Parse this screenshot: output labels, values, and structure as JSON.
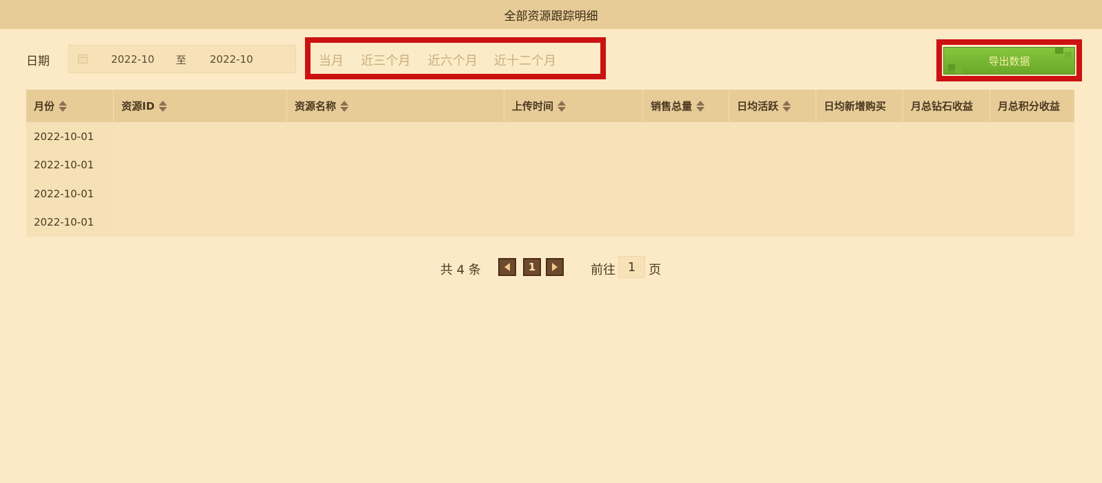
{
  "header": {
    "title": "全部资源跟踪明细"
  },
  "filters": {
    "date_label": "日期",
    "date_from": "2022-10",
    "date_sep": "至",
    "date_to": "2022-10",
    "quick_ranges": [
      "当月",
      "近三个月",
      "近六个月",
      "近十二个月"
    ]
  },
  "toolbar": {
    "export_label": "导出数据"
  },
  "table": {
    "columns": [
      "月份",
      "资源ID",
      "资源名称",
      "上传时间",
      "销售总量",
      "日均活跃",
      "日均新增购买",
      "月总钻石收益",
      "月总积分收益"
    ],
    "rows": [
      {
        "month": "2022-10-01"
      },
      {
        "month": "2022-10-01"
      },
      {
        "month": "2022-10-01"
      },
      {
        "month": "2022-10-01"
      }
    ]
  },
  "pagination": {
    "total_text": "共 4 条",
    "current_page": "1",
    "goto_label": "前往",
    "goto_value": "1",
    "goto_suffix": "页"
  },
  "colors": {
    "background": "#fceac6",
    "header_bar": "#e7cc98",
    "highlight_border": "#cc1111",
    "export_green": "#7bb935",
    "pager_brown": "#6e4a2c"
  }
}
